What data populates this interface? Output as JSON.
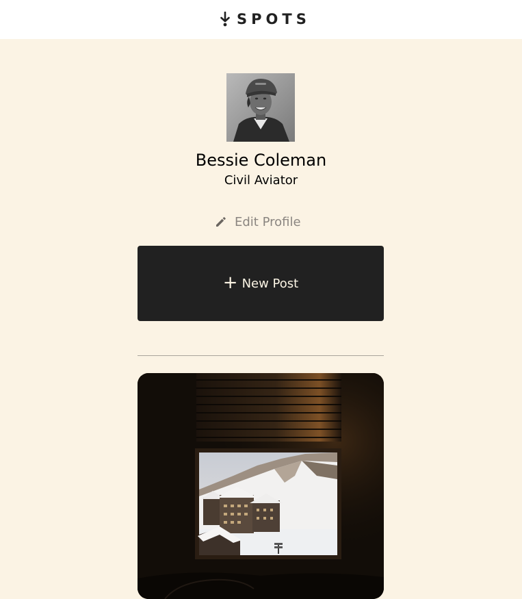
{
  "header": {
    "logo_text": "SPOTS"
  },
  "profile": {
    "name": "Bessie Coleman",
    "job": "Civil Aviator",
    "avatar_alt": "Bessie Coleman"
  },
  "actions": {
    "edit_profile_label": "Edit Profile",
    "new_post_label": "New Post",
    "new_post_icon": "+"
  },
  "cards": [
    {
      "image": "window-view-snowy-mountain-lodge",
      "image_alt": ""
    }
  ],
  "colors": {
    "background": "#fbf3e4",
    "header_bg": "#ffffff",
    "button_bg": "#212121",
    "button_text": "#fcf5e5",
    "edit_text": "#8a8580",
    "divider": "#a9a39b"
  }
}
